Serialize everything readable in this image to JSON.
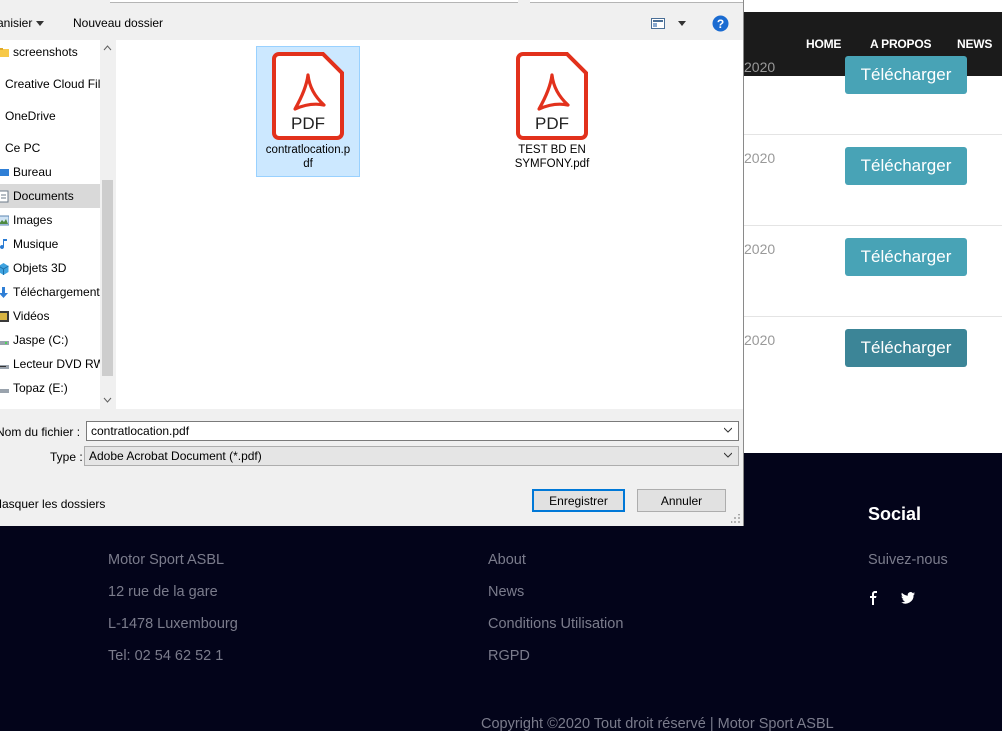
{
  "website": {
    "nav": [
      "HOME",
      "A PROPOS",
      "NEWS"
    ],
    "rows": [
      {
        "date": "2020",
        "button": "Télécharger"
      },
      {
        "date": "2020",
        "button": "Télécharger"
      },
      {
        "date": "2020",
        "button": "Télécharger"
      },
      {
        "date": "2020",
        "button": "Télécharger"
      }
    ],
    "footer": {
      "company": [
        "Motor Sport ASBL",
        "12 rue de la gare",
        "L-1478 Luxembourg",
        "Tel: 02 54 62 52 1"
      ],
      "links": [
        "About",
        "News",
        "Conditions Utilisation",
        "RGPD"
      ],
      "social_title": "Social",
      "social_subtitle": "Suivez-nous",
      "social_icons": [
        "facebook-icon",
        "twitter-icon"
      ],
      "copyright": "Copyright ©2020 Tout droit réservé | Motor Sport ASBL"
    },
    "colors": {
      "button": "#48a3b6",
      "button_hover": "#3c8597",
      "footer_bg": "#03041a",
      "topbar_bg": "#1b1b1b"
    }
  },
  "dialog": {
    "toolbar": {
      "organize": "anisier",
      "new_folder": "Nouveau dossier",
      "help": "?"
    },
    "nav_items": [
      {
        "label": "screenshots",
        "icon": "folder-icon"
      },
      {
        "label": "Creative Cloud Fil",
        "icon": "cloud-icon"
      },
      {
        "label": "OneDrive",
        "icon": "onedrive-icon"
      },
      {
        "label": "Ce PC",
        "icon": "computer-icon"
      },
      {
        "label": "Bureau",
        "icon": "desktop-icon"
      },
      {
        "label": "Documents",
        "icon": "documents-icon"
      },
      {
        "label": "Images",
        "icon": "images-icon"
      },
      {
        "label": "Musique",
        "icon": "music-icon"
      },
      {
        "label": "Objets 3D",
        "icon": "objects-3d-icon"
      },
      {
        "label": "Téléchargements",
        "icon": "downloads-icon"
      },
      {
        "label": "Vidéos",
        "icon": "videos-icon"
      },
      {
        "label": "Jaspe (C:)",
        "icon": "drive-icon"
      },
      {
        "label": "Lecteur DVD RW",
        "icon": "dvd-icon"
      },
      {
        "label": "Topaz (E:)",
        "icon": "drive-icon"
      }
    ],
    "selected_nav": "Documents",
    "files": [
      {
        "name_line1": "contratlocation.p",
        "name_line2": "df",
        "icon": "pdf-icon",
        "selected": true
      },
      {
        "name_line1": "TEST BD EN",
        "name_line2": "SYMFONY.pdf",
        "icon": "pdf-icon",
        "selected": false
      }
    ],
    "pdf_icon_text": "PDF",
    "filename_label": "Nom du fichier :",
    "filename_value": "contratlocation.pdf",
    "type_label": "Type :",
    "type_value": "Adobe Acrobat Document (*.pdf)",
    "hide_folders": "Masquer les dossiers",
    "save_button": "Enregistrer",
    "cancel_button": "Annuler"
  }
}
